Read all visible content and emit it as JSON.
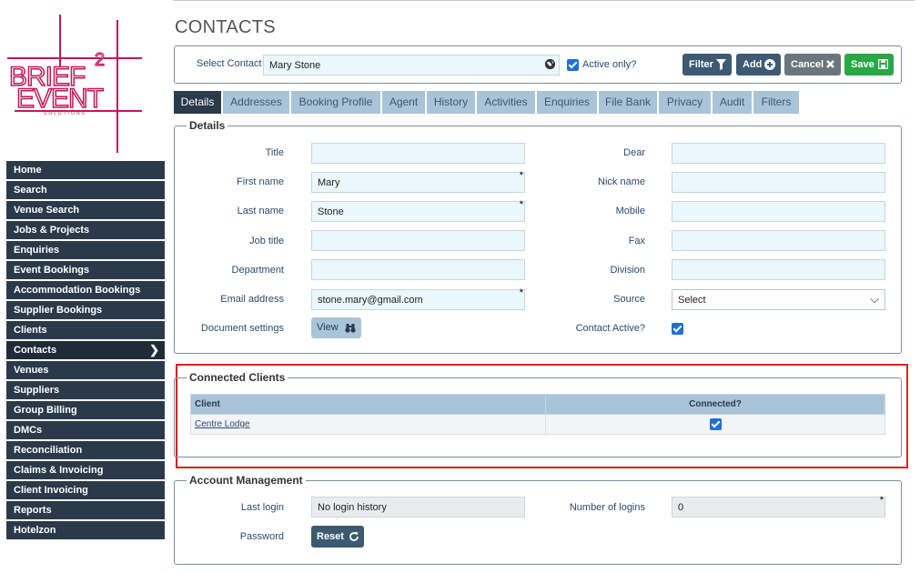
{
  "logo": {
    "brand": "BRIEF 2 EVENT",
    "tagline": "SOLUTIONS"
  },
  "sidebar": {
    "items": [
      {
        "label": "Home"
      },
      {
        "label": "Search"
      },
      {
        "label": "Venue Search"
      },
      {
        "label": "Jobs & Projects"
      },
      {
        "label": "Enquiries"
      },
      {
        "label": "Event Bookings"
      },
      {
        "label": "Accommodation Bookings"
      },
      {
        "label": "Supplier Bookings"
      },
      {
        "label": "Clients"
      },
      {
        "label": "Contacts",
        "active": true
      },
      {
        "label": "Venues"
      },
      {
        "label": "Suppliers"
      },
      {
        "label": "Group Billing"
      },
      {
        "label": "DMCs"
      },
      {
        "label": "Reconciliation"
      },
      {
        "label": "Claims & Invoicing"
      },
      {
        "label": "Client Invoicing"
      },
      {
        "label": "Reports"
      },
      {
        "label": "Hotelzon"
      }
    ]
  },
  "page": {
    "title": "CONTACTS"
  },
  "select_bar": {
    "label": "Select Contact",
    "value": "Mary Stone",
    "active_only_label": "Active only?",
    "active_only_checked": true,
    "filter_label": "Filter",
    "add_label": "Add",
    "cancel_label": "Cancel",
    "save_label": "Save"
  },
  "tabs": [
    "Details",
    "Addresses",
    "Booking Profile",
    "Agent",
    "History",
    "Activities",
    "Enquiries",
    "File Bank",
    "Privacy",
    "Audit",
    "Filters"
  ],
  "details": {
    "legend": "Details",
    "title_label": "Title",
    "title_value": "",
    "first_name_label": "First name",
    "first_name_value": "Mary",
    "last_name_label": "Last name",
    "last_name_value": "Stone",
    "job_title_label": "Job title",
    "job_title_value": "",
    "department_label": "Department",
    "department_value": "",
    "email_label": "Email address",
    "email_value": "stone.mary@gmail.com",
    "doc_settings_label": "Document settings",
    "view_label": "View",
    "dear_label": "Dear",
    "dear_value": "",
    "nick_name_label": "Nick name",
    "nick_name_value": "",
    "mobile_label": "Mobile",
    "mobile_value": "",
    "fax_label": "Fax",
    "fax_value": "",
    "division_label": "Division",
    "division_value": "",
    "source_label": "Source",
    "source_value": "Select",
    "contact_active_label": "Contact Active?",
    "contact_active_checked": true
  },
  "connected_clients": {
    "legend": "Connected Clients",
    "col_client": "Client",
    "col_connected": "Connected?",
    "rows": [
      {
        "client": "Centre Lodge",
        "connected": true
      }
    ]
  },
  "account": {
    "legend": "Account Management",
    "last_login_label": "Last login",
    "last_login_value": "No login history",
    "logins_label": "Number of logins",
    "logins_value": "0",
    "password_label": "Password",
    "reset_label": "Reset"
  },
  "colors": {
    "nav": "#2b3a4a",
    "tab": "#a9c4d8",
    "save": "#28a745",
    "logo": "#c2185b",
    "highlight": "#e02020"
  }
}
